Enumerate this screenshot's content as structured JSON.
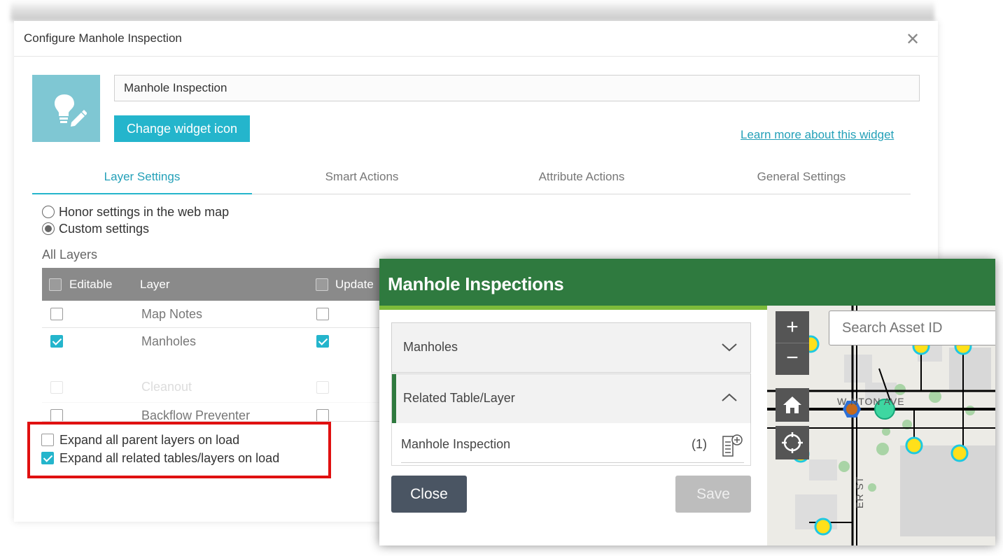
{
  "config_dialog": {
    "title": "Configure Manhole Inspection",
    "close_glyph": "✕",
    "widget_name_value": "Manhole Inspection",
    "change_icon_label": "Change widget icon",
    "learn_more_label": "Learn more about this widget",
    "icon": "lightbulb-pencil-icon",
    "icon_bg_color": "#7fc7d3",
    "accent_color": "#24b5cc",
    "tabs": [
      {
        "label": "Layer Settings",
        "active": true
      },
      {
        "label": "Smart Actions",
        "active": false
      },
      {
        "label": "Attribute Actions",
        "active": false
      },
      {
        "label": "General Settings",
        "active": false
      }
    ],
    "radio_options": [
      {
        "label": "Honor settings in the web map",
        "selected": false
      },
      {
        "label": "Custom settings",
        "selected": true
      }
    ],
    "all_layers_label": "All Layers",
    "table": {
      "columns": [
        "Editable",
        "Layer",
        "Update"
      ],
      "rows": [
        {
          "layer": "Map Notes",
          "editable": false,
          "update": false
        },
        {
          "layer": "Manholes",
          "editable": true,
          "update": true
        },
        {
          "layer": "Cleanout",
          "editable": false,
          "update": false
        },
        {
          "layer": "Backflow Preventer",
          "editable": false,
          "update": false
        }
      ]
    },
    "expand_options": [
      {
        "label": "Expand all parent layers on load",
        "checked": false
      },
      {
        "label": "Expand all related tables/layers on load",
        "checked": true
      }
    ],
    "highlight_color": "#e01010"
  },
  "app": {
    "title": "Manhole Inspections",
    "header_color": "#2f7a3f",
    "accent_color": "#7dbb3a",
    "accordion": [
      {
        "label": "Manholes",
        "expanded": false
      },
      {
        "label": "Related Table/Layer",
        "expanded": true
      }
    ],
    "related_item": {
      "label": "Manhole Inspection",
      "count": "(1)"
    },
    "close_label": "Close",
    "save_label": "Save",
    "map": {
      "search_placeholder": "Search Asset ID",
      "zoom_in": "+",
      "zoom_out": "−",
      "street_1": "W     NTON AVE",
      "street_2": "ER ST"
    }
  }
}
